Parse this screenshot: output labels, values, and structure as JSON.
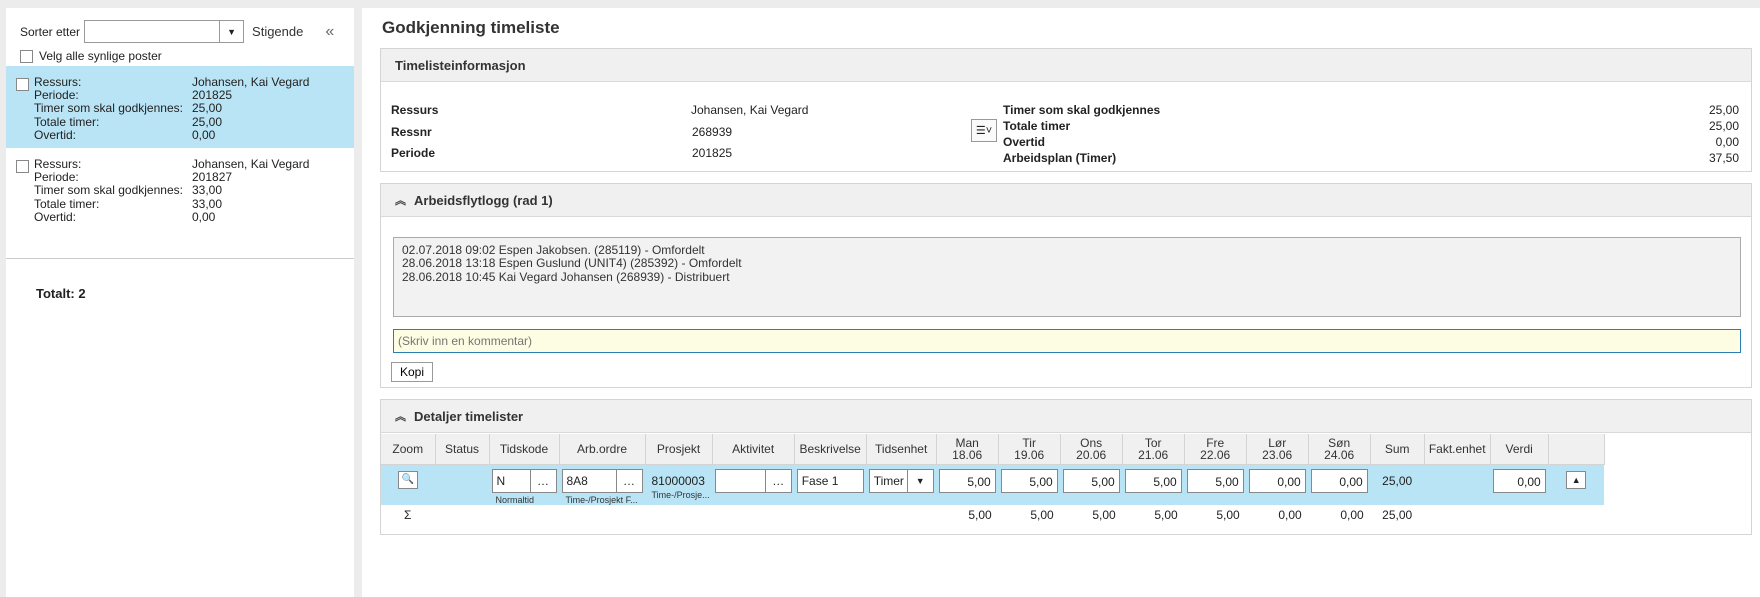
{
  "sidebar": {
    "sort_label": "Sorter etter",
    "sort_value": "",
    "ascending": "Stigende",
    "select_all": "Velg alle synlige poster",
    "records": [
      {
        "labels": [
          "Ressurs:",
          "Periode:",
          "Timer som skal godkjennes:",
          "Totale timer:",
          "Overtid:"
        ],
        "values": [
          "Johansen, Kai Vegard",
          "201825",
          "25,00",
          "25,00",
          "0,00"
        ]
      },
      {
        "labels": [
          "Ressurs:",
          "Periode:",
          "Timer som skal godkjennes:",
          "Totale timer:",
          "Overtid:"
        ],
        "values": [
          "Johansen, Kai Vegard",
          "201827",
          "33,00",
          "33,00",
          "0,00"
        ]
      }
    ],
    "total": "Totalt: 2"
  },
  "main": {
    "title": "Godkjenning timeliste",
    "info": {
      "header": "Timelisteinformasjon",
      "ressurs_label": "Ressurs",
      "ressurs_value": "Johansen, Kai Vegard",
      "ressnr_label": "Ressnr",
      "ressnr_value": "268939",
      "periode_label": "Periode",
      "periode_value": "201825",
      "timer_label": "Timer som skal godkjennes",
      "timer_value": "25,00",
      "totale_label": "Totale timer",
      "totale_value": "25,00",
      "overtid_label": "Overtid",
      "overtid_value": "0,00",
      "plan_label": "Arbeidsplan (Timer)",
      "plan_value": "37,50"
    },
    "workflow": {
      "header": "Arbeidsflytlogg (rad 1)",
      "log": [
        "02.07.2018 09:02 Espen Jakobsen. (285119) - Omfordelt",
        "28.06.2018 13:18 Espen Guslund (UNIT4) (285392) - Omfordelt",
        "28.06.2018 10:45 Kai Vegard Johansen (268939) - Distribuert"
      ],
      "comment_placeholder": "(Skriv inn en kommentar)",
      "copy_button": "Kopi"
    },
    "details": {
      "header": "Detaljer timelister",
      "columns": {
        "zoom": "Zoom",
        "status": "Status",
        "tidskode": "Tidskode",
        "arbordre": "Arb.ordre",
        "prosjekt": "Prosjekt",
        "aktivitet": "Aktivitet",
        "beskrivelse": "Beskrivelse",
        "tidsenhet": "Tidsenhet",
        "days": [
          {
            "day": "Man",
            "date": "18.06"
          },
          {
            "day": "Tir",
            "date": "19.06"
          },
          {
            "day": "Ons",
            "date": "20.06"
          },
          {
            "day": "Tor",
            "date": "21.06"
          },
          {
            "day": "Fre",
            "date": "22.06"
          },
          {
            "day": "Lør",
            "date": "23.06"
          },
          {
            "day": "Søn",
            "date": "24.06"
          }
        ],
        "sum": "Sum",
        "faktenhet": "Fakt.enhet",
        "verdi": "Verdi"
      },
      "row": {
        "tidskode": "N",
        "tidskode_sub": "Normaltid",
        "arbordre": "8A8",
        "arbordre_sub": "Time-/Prosjekt F...",
        "prosjekt": "81000003",
        "prosjekt_sub": "Time-/Prosje...",
        "aktivitet": "",
        "beskrivelse": "Fase 1",
        "tidsenhet": "Timer",
        "hours": [
          "5,00",
          "5,00",
          "5,00",
          "5,00",
          "5,00",
          "0,00",
          "0,00"
        ],
        "sum": "25,00",
        "verdi": "0,00"
      },
      "sum_row": {
        "sigma": "Σ",
        "hours": [
          "5,00",
          "5,00",
          "5,00",
          "5,00",
          "5,00",
          "0,00",
          "0,00"
        ],
        "sum": "25,00"
      }
    }
  }
}
